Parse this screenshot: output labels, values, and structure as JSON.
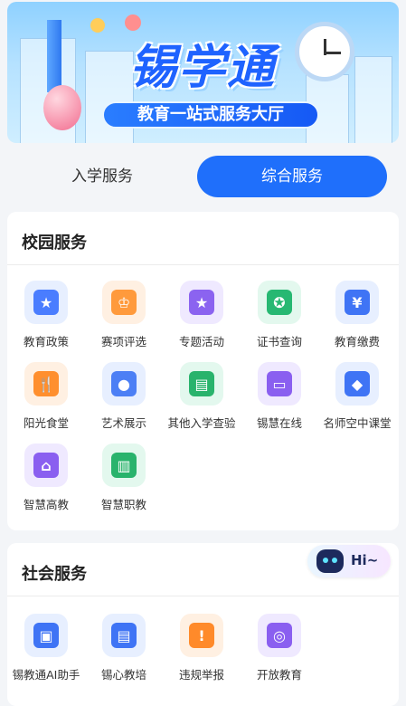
{
  "banner": {
    "title": "锡学通",
    "subtitle": "教育一站式服务大厅"
  },
  "tabs": [
    {
      "label": "入学服务",
      "active": false
    },
    {
      "label": "综合服务",
      "active": true
    }
  ],
  "campus": {
    "title": "校园服务",
    "items": [
      {
        "label": "教育政策",
        "icon": "policy-icon",
        "bg": "#e7efff",
        "fg": "#4a7dff",
        "glyph": "★"
      },
      {
        "label": "赛项评选",
        "icon": "trophy-icon",
        "bg": "#fff0e2",
        "fg": "#ff9a3c",
        "glyph": "♔"
      },
      {
        "label": "专题活动",
        "icon": "activity-icon",
        "bg": "#efe9ff",
        "fg": "#8b63f0",
        "glyph": "★"
      },
      {
        "label": "证书查询",
        "icon": "certificate-icon",
        "bg": "#e3f8ee",
        "fg": "#27b872",
        "glyph": "✪"
      },
      {
        "label": "教育缴费",
        "icon": "payment-icon",
        "bg": "#e7efff",
        "fg": "#3f74f5",
        "glyph": "¥"
      },
      {
        "label": "阳光食堂",
        "icon": "canteen-icon",
        "bg": "#fff0e2",
        "fg": "#ff8f2e",
        "glyph": "🍴"
      },
      {
        "label": "艺术展示",
        "icon": "palette-icon",
        "bg": "#e7efff",
        "fg": "#4c7ff5",
        "glyph": "●"
      },
      {
        "label": "其他入学查验",
        "icon": "id-card-icon",
        "bg": "#e3f8ee",
        "fg": "#29b36c",
        "glyph": "▤"
      },
      {
        "label": "锡慧在线",
        "icon": "screen-icon",
        "bg": "#efe9ff",
        "fg": "#8a5ff0",
        "glyph": "▭"
      },
      {
        "label": "名师空中课堂",
        "icon": "graduation-cap-icon",
        "bg": "#e7efff",
        "fg": "#3f74f5",
        "glyph": "◆"
      },
      {
        "label": "智慧高教",
        "icon": "university-icon",
        "bg": "#efe9ff",
        "fg": "#8a5ff0",
        "glyph": "⌂"
      },
      {
        "label": "智慧职教",
        "icon": "building-icon",
        "bg": "#e3f8ee",
        "fg": "#29b36c",
        "glyph": "▥"
      }
    ]
  },
  "social": {
    "title": "社会服务",
    "items": [
      {
        "label": "锡教通AI助手",
        "icon": "chat-icon",
        "bg": "#e7efff",
        "fg": "#3f74f5",
        "glyph": "▣"
      },
      {
        "label": "锡心教培",
        "icon": "card-icon",
        "bg": "#e7efff",
        "fg": "#3f74f5",
        "glyph": "▤"
      },
      {
        "label": "违规举报",
        "icon": "warning-icon",
        "bg": "#fff0e2",
        "fg": "#ff8a2a",
        "glyph": "!"
      },
      {
        "label": "开放教育",
        "icon": "open-education-icon",
        "bg": "#efe9ff",
        "fg": "#8a5ff0",
        "glyph": "◎"
      }
    ]
  },
  "assistant": {
    "text": "Hi~"
  }
}
